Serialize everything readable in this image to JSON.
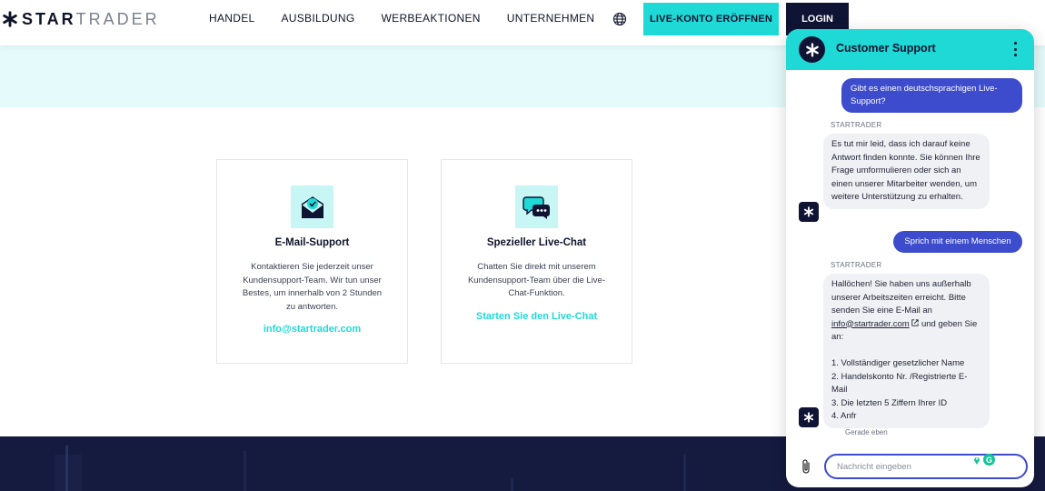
{
  "header": {
    "logo_bold": "STAR",
    "logo_light": "TRADER",
    "nav": [
      "HANDEL",
      "AUSBILDUNG",
      "WERBEAKTIONEN",
      "UNTERNEHMEN"
    ],
    "cta_live": "LIVE-KONTO ERÖFFNEN",
    "cta_login": "LOGIN"
  },
  "cards": [
    {
      "title": "E-Mail-Support",
      "text": "Kontaktieren Sie jederzeit unser Kundensupport-Team. Wir tun unser Bestes, um innerhalb von 2 Stunden zu antworten.",
      "link": "info@startrader.com",
      "icon": "envelope-check-icon"
    },
    {
      "title": "Spezieller Live-Chat",
      "text": "Chatten Sie direkt mit unserem Kundensupport-Team über die Live-Chat-Funktion.",
      "link": "Starten Sie den Live-Chat",
      "icon": "chat-bubbles-icon"
    }
  ],
  "chat": {
    "title": "Customer Support",
    "messages": [
      {
        "from": "user",
        "text": "Gibt es einen deutschsprachigen Live-Support?"
      },
      {
        "from": "bot",
        "sender": "STARTRADER",
        "text": "Es tut mir leid, dass ich darauf keine Antwort finden konnte. Sie können Ihre Frage umformulieren oder sich an einen unserer Mitarbeiter wenden, um weitere Unterstützung zu erhalten."
      },
      {
        "from": "user",
        "text": "Sprich mit einem Menschen"
      },
      {
        "from": "bot",
        "sender": "STARTRADER",
        "intro": "Hallöchen! Sie haben uns außerhalb unserer Arbeitszeiten erreicht. Bitte senden Sie eine E-Mail an",
        "link": "info@startrader.com",
        "after_link": "und geben Sie an:",
        "items": [
          "1. Vollständiger gesetzlicher Name",
          "2. Handelskonto Nr. /Registrierte E-Mail",
          "3. Die letzten 5 Ziffern Ihrer ID",
          "4. Anfr"
        ]
      }
    ],
    "timestamp": "Gerade eben",
    "input_placeholder": "Nachricht eingeben"
  },
  "colors": {
    "accent": "#1fd9d6",
    "navy": "#0f1434",
    "user_bubble": "#3d4ccc",
    "band": "#e5fbfb"
  }
}
